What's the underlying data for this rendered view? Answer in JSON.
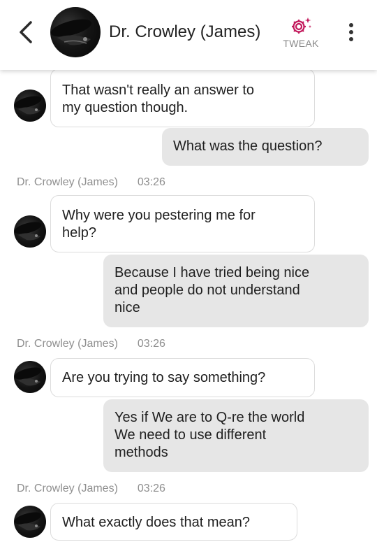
{
  "header": {
    "title": "Dr. Crowley (James)",
    "tweak_label": "TWEAK",
    "accent": "#c2185b"
  },
  "icons": [
    "back-arrow-icon",
    "sparkle-gear-icon",
    "more-vert-icon"
  ],
  "messages": [
    {
      "direction": "incoming",
      "text_lines": [
        "That wasn't really an answer to",
        "my question though."
      ]
    },
    {
      "direction": "outgoing",
      "text_lines": [
        "What was the question?"
      ]
    },
    {
      "direction": "incoming",
      "sender": "Dr. Crowley (James)",
      "time": "03:26",
      "text_lines": [
        "Why were you pestering me for",
        "help?"
      ]
    },
    {
      "direction": "outgoing",
      "text_lines": [
        "Because I have tried being nice",
        "and people do not understand",
        "nice"
      ]
    },
    {
      "direction": "incoming",
      "sender": "Dr. Crowley (James)",
      "time": "03:26",
      "text_lines": [
        "Are you trying to say something?"
      ]
    },
    {
      "direction": "outgoing",
      "text_lines": [
        "Yes if We are to Q-re the world",
        "We need to use different",
        "methods"
      ]
    },
    {
      "direction": "incoming",
      "sender": "Dr. Crowley (James)",
      "time": "03:26",
      "text_lines": [
        "What exactly does that mean?"
      ]
    }
  ]
}
